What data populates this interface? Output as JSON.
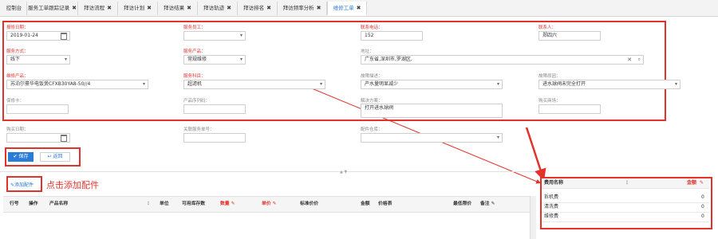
{
  "tabs": [
    {
      "label": "控制台",
      "closable": false
    },
    {
      "label": "服务工单跟踪记录",
      "closable": true
    },
    {
      "label": "拜访流程",
      "closable": true
    },
    {
      "label": "拜访计划",
      "closable": true
    },
    {
      "label": "拜访结果",
      "closable": true
    },
    {
      "label": "拜访轨迹",
      "closable": true
    },
    {
      "label": "拜访排名",
      "closable": true
    },
    {
      "label": "拜访频率分析",
      "closable": true
    },
    {
      "label": "维修工单",
      "closable": true,
      "active": true
    }
  ],
  "close_glyph": "✖",
  "form": {
    "report_date": {
      "label": "报修日期：",
      "value": "2019-01-24"
    },
    "service_staff": {
      "label": "服务员工：",
      "value": ""
    },
    "contact_phone": {
      "label": "联系电话：",
      "value": "152"
    },
    "contact_person": {
      "label": "联系人：",
      "value": "郑四六"
    },
    "service_mode": {
      "label": "服务方式：",
      "value": "线下"
    },
    "service_product": {
      "label": "服务产品：",
      "value": "常规维修"
    },
    "address": {
      "label": "地址：",
      "value": "广东省,深圳市,罗湖区,"
    },
    "repair_product": {
      "label": "维修产品：",
      "value": "苏泊尔豪华电饭煲CFXB30YA8-50//4"
    },
    "service_subject": {
      "label": "服务科目：",
      "value": "超滤机"
    },
    "fault_desc": {
      "label": "故障描述：",
      "value": "产水量明显减少"
    },
    "fault_reason": {
      "label": "故障原因：",
      "value": "进水球阀未完全打开"
    },
    "warranty_card": {
      "label": "保修卡：",
      "value": ""
    },
    "product_serial": {
      "label": "产品序列码：",
      "value": ""
    },
    "solution": {
      "label": "解决方案：",
      "value": "打开进水球阀"
    },
    "purchase_mall": {
      "label": "购买商场：",
      "value": ""
    },
    "purchase_date": {
      "label": "购买日期：",
      "value": ""
    },
    "related_order": {
      "label": "关联服务单号：",
      "value": ""
    },
    "parts_warehouse": {
      "label": "配件仓库：",
      "value": ""
    }
  },
  "buttons": {
    "save": "保存",
    "back": "返回",
    "add_part": "添加配件"
  },
  "annotation": "点击添加配件",
  "parts_table": {
    "headers": [
      "行号",
      "操作",
      "产品名称",
      "单位",
      "可用库存数",
      "数量",
      "单价",
      "标准价价",
      "金额",
      "价格表",
      "最低限价",
      "备注"
    ]
  },
  "fee_table": {
    "headers": [
      "费用名称",
      "金额"
    ],
    "rows": [
      {
        "name": "拆机费",
        "amount": "0"
      },
      {
        "name": "清洗费",
        "amount": "0"
      },
      {
        "name": "维修费",
        "amount": "0"
      }
    ]
  },
  "colors": {
    "accent": "#2a7cd6",
    "highlight": "#e2332b"
  }
}
